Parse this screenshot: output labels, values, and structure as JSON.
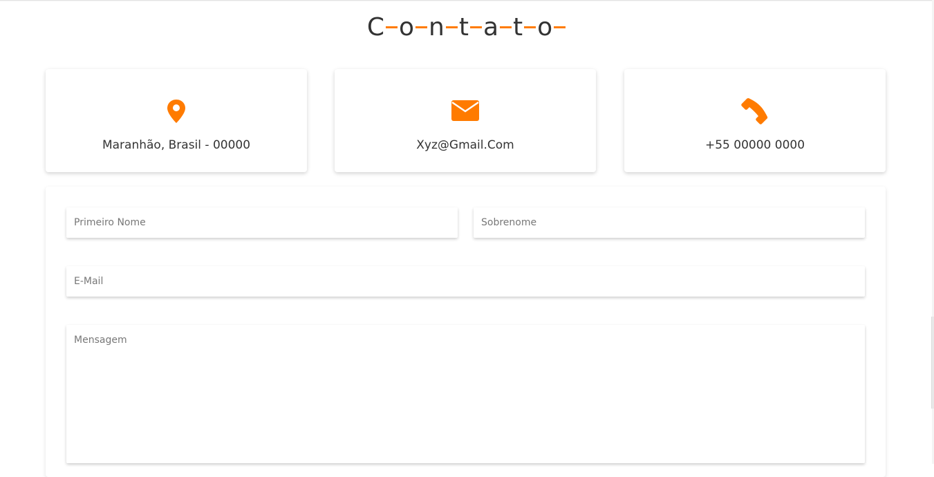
{
  "title": {
    "letters": [
      "C",
      "o",
      "n",
      "t",
      "a",
      "t",
      "o"
    ]
  },
  "accent_color": "#ff7b00",
  "info_cards": [
    {
      "icon": "map-marker-icon",
      "text": "Maranhão, Brasil - 00000"
    },
    {
      "icon": "envelope-icon",
      "text": "Xyz@Gmail.Com"
    },
    {
      "icon": "phone-icon",
      "text": "+55 00000 0000"
    }
  ],
  "form": {
    "first_name": {
      "placeholder": "Primeiro Nome",
      "value": ""
    },
    "last_name": {
      "placeholder": "Sobrenome",
      "value": ""
    },
    "email": {
      "placeholder": "E-Mail",
      "value": ""
    },
    "message": {
      "placeholder": "Mensagem",
      "value": ""
    }
  }
}
